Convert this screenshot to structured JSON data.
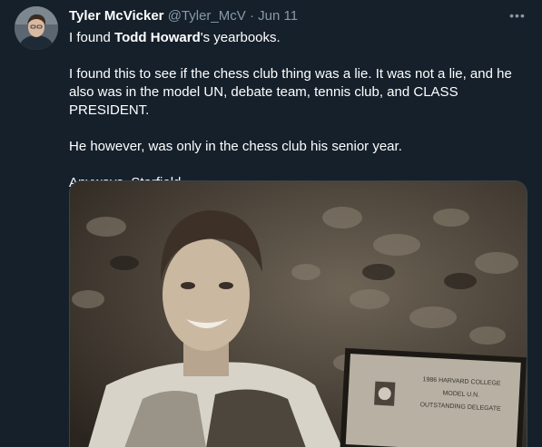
{
  "author": {
    "display_name": "Tyler McVicker",
    "handle": "@Tyler_McV",
    "separator": "·",
    "date": "Jun 11",
    "avatar_icon": "user-avatar"
  },
  "more_icon": "more-horizontal-icon",
  "tweet": {
    "line1_pre": "I found ",
    "line1_bold": "Todd Howard",
    "line1_post": "'s yearbooks.",
    "para2": "I found this to see if the chess club thing was a lie. It was not a lie, and he also was in the model UN, debate team, tennis club, and CLASS PRESIDENT.",
    "para3": "He however, was only in the chess club his senior year.",
    "para4": "Anyways, Starfield."
  },
  "media": {
    "plaque_lines": [
      "1986 HARVARD COLLEGE",
      "MODEL U.N.",
      "OUTSTANDING DELEGATE"
    ]
  },
  "colors": {
    "background": "#15202b",
    "text": "#ffffff",
    "secondary": "#8899a6",
    "border": "#38444d"
  }
}
